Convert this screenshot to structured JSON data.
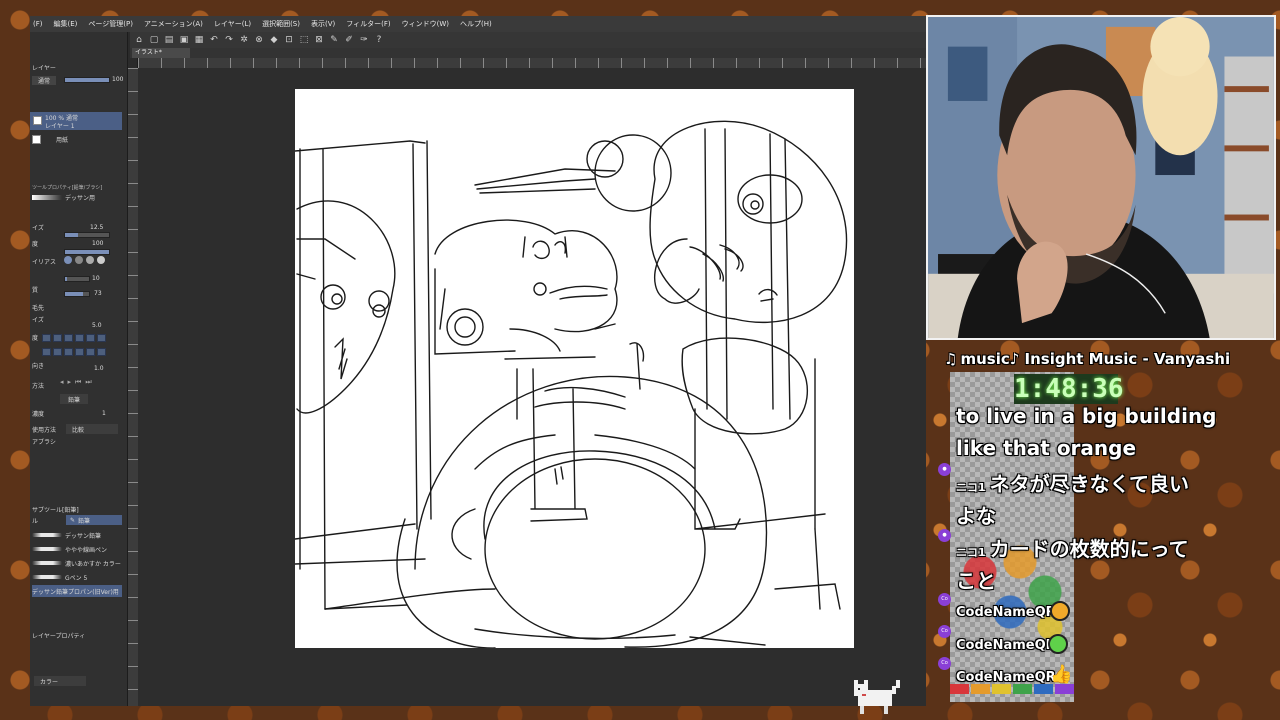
{
  "app": {
    "menu": [
      "(F)",
      "編集(E)",
      "ページ管理(P)",
      "アニメーション(A)",
      "レイヤー(L)",
      "選択範囲(S)",
      "表示(V)",
      "フィルター(F)",
      "ウィンドウ(W)",
      "ヘルプ(H)"
    ],
    "document_tab": "イラスト*",
    "left_panel": {
      "layer_header": "レイヤー",
      "blend_mode": "通常",
      "opacity": "100",
      "layer_1_name": "100 % 通常",
      "layer_1_sub": "レイヤー 1",
      "paper_layer": "用紙",
      "tool_property_title": "ツールプロパティ[鉛筆/ブラシ]",
      "tool_property_sub": "デッサン用",
      "size_label": "イズ",
      "size_value": "12.5",
      "density_label": "度",
      "density_value": "100",
      "antialias_label": "イリアス",
      "hardness_value": "10",
      "stabilize_label": "質",
      "stabilize_value": "73",
      "brush_label": "毛先",
      "brush_size_label": "イズ",
      "brush_size_value": "5.0",
      "thickness_label": "度",
      "dir_label": "向き",
      "dir_value": "1.0",
      "spray_label": "方法",
      "pencil_label": "鉛筆",
      "ink_label": "濃度",
      "ink_value": "1",
      "method_label": "使用方法",
      "method_value": "比較",
      "airbrush_label": "アブラシ",
      "sub_tool_title": "サブツール[鉛筆]",
      "sub_tool_tab_1": "ル",
      "sub_tool_tab_2": "鉛筆",
      "brushes": [
        "デッサン鉛筆",
        "ややや線画ペン",
        "濃いあかすか カラー",
        "Gペン 5",
        "デッサン鉛筆プロパン(旧Ver)用"
      ],
      "layer_property": "レイヤープロパティ",
      "color_label": "カラー"
    }
  },
  "stream": {
    "music": "music♪ Insight Music - Vanyashi",
    "timer": "1:48:36",
    "chat": [
      {
        "text": "to live in a big building"
      },
      {
        "text": "like that orange"
      },
      {
        "source": "ニコ1",
        "text": "ネタが尽きなくて良い"
      },
      {
        "text": "よな"
      },
      {
        "source": "ニコ1",
        "text": "カードの枚数的にって"
      },
      {
        "text": "こと"
      }
    ],
    "users": [
      {
        "name": "CodeNameQR",
        "emoji_color": "#f0a92a"
      },
      {
        "name": "CodeNameQR",
        "emoji_color": "#5fd14a"
      },
      {
        "name": "CodeNameQR",
        "emoji_color": "#f4c542"
      }
    ],
    "badge_text": "Co"
  }
}
